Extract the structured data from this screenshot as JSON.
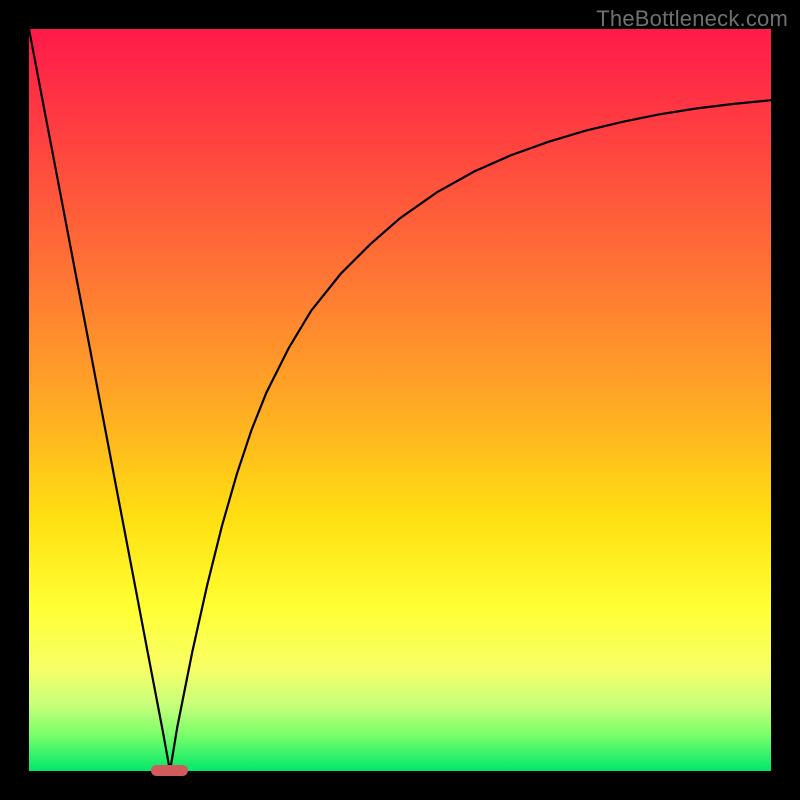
{
  "watermark": "TheBottleneck.com",
  "chart_data": {
    "type": "line",
    "title": "",
    "xlabel": "",
    "ylabel": "",
    "xlim": [
      0,
      100
    ],
    "ylim": [
      0,
      100
    ],
    "grid": false,
    "x": [
      0,
      2,
      4,
      6,
      8,
      10,
      12,
      14,
      16,
      18,
      19,
      20,
      22,
      24,
      26,
      28,
      30,
      32,
      35,
      38,
      42,
      46,
      50,
      55,
      60,
      65,
      70,
      75,
      80,
      85,
      90,
      95,
      100
    ],
    "series": [
      {
        "name": "left-branch",
        "x": [
          0,
          2,
          4,
          6,
          8,
          10,
          12,
          14,
          16,
          18,
          19
        ],
        "values": [
          100,
          89.5,
          79,
          68.5,
          58,
          47.5,
          37,
          26.5,
          16,
          5.5,
          0
        ]
      },
      {
        "name": "right-branch",
        "x": [
          19,
          20,
          22,
          24,
          26,
          28,
          30,
          32,
          35,
          38,
          42,
          46,
          50,
          55,
          60,
          65,
          70,
          75,
          80,
          85,
          90,
          95,
          100
        ],
        "values": [
          0,
          6,
          16,
          25,
          33,
          40,
          46,
          51,
          57,
          62,
          67,
          71,
          74.5,
          78,
          80.8,
          83,
          84.8,
          86.3,
          87.5,
          88.5,
          89.3,
          89.9,
          90.4
        ]
      }
    ],
    "annotations": [
      {
        "type": "marker",
        "shape": "pill",
        "color": "#d15a5a",
        "x": 19,
        "y": 0,
        "w": 5,
        "h": 1.5
      }
    ]
  },
  "dimensions": {
    "outer_w": 800,
    "outer_h": 800,
    "inner_w": 742,
    "inner_h": 742
  }
}
